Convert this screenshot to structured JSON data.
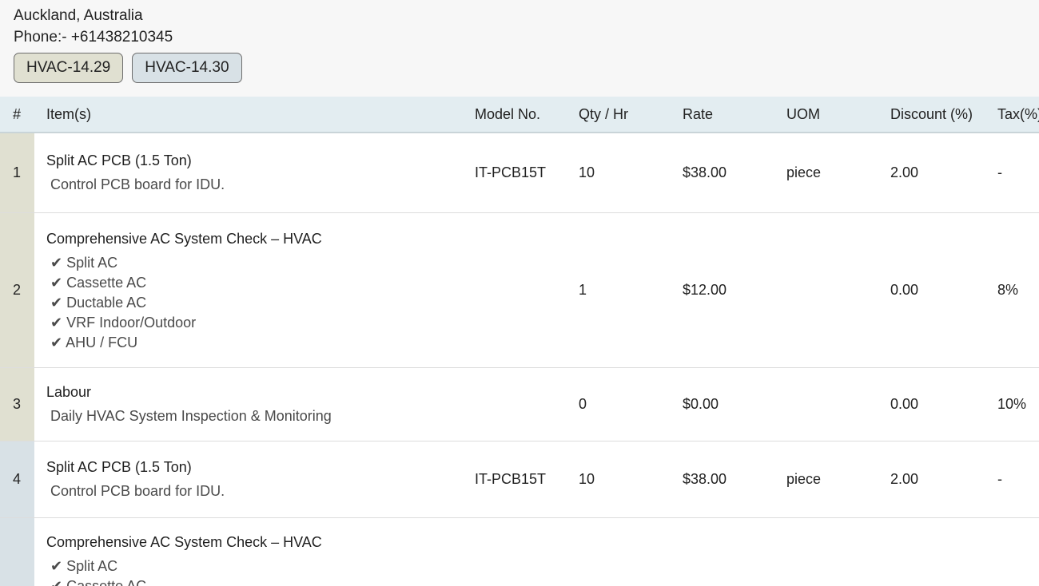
{
  "header": {
    "address": "Auckland, Australia",
    "phone": "Phone:- +61438210345"
  },
  "tabs": [
    {
      "label": "HVAC-14.29",
      "color": "#e0e0d1"
    },
    {
      "label": "HVAC-14.30",
      "color": "#d8e1e6"
    }
  ],
  "table": {
    "columns": [
      "#",
      "Item(s)",
      "Model No.",
      "Qty / Hr",
      "Rate",
      "UOM",
      "Discount (%)",
      "Tax(%)"
    ],
    "rows": [
      {
        "num": "1",
        "name": "Split AC PCB (1.5 Ton)",
        "desc": [
          "Control PCB board for IDU."
        ],
        "model": "IT-PCB15T",
        "qty": "10",
        "rate": "$38.00",
        "uom": "piece",
        "discount": "2.00",
        "tax": "-"
      },
      {
        "num": "2",
        "name": "Comprehensive AC System Check – HVAC",
        "desc": [
          "✔ Split AC",
          "✔ Cassette AC",
          "✔ Ductable AC",
          "✔ VRF Indoor/Outdoor",
          "✔ AHU / FCU"
        ],
        "model": "",
        "qty": "1",
        "rate": "$12.00",
        "uom": "",
        "discount": "0.00",
        "tax": "8%"
      },
      {
        "num": "3",
        "name": "Labour",
        "desc": [
          "Daily HVAC System Inspection & Monitoring"
        ],
        "model": "",
        "qty": "0",
        "rate": "$0.00",
        "uom": "",
        "discount": "0.00",
        "tax": "10%"
      },
      {
        "num": "4",
        "name": "Split AC PCB (1.5 Ton)",
        "desc": [
          "Control PCB board for IDU."
        ],
        "model": "IT-PCB15T",
        "qty": "10",
        "rate": "$38.00",
        "uom": "piece",
        "discount": "2.00",
        "tax": "-"
      },
      {
        "num": "",
        "name": "Comprehensive AC System Check – HVAC",
        "desc": [
          "✔ Split AC",
          "✔ Cassette AC"
        ],
        "model": "",
        "qty": "",
        "rate": "",
        "uom": "",
        "discount": "",
        "tax": ""
      }
    ]
  }
}
